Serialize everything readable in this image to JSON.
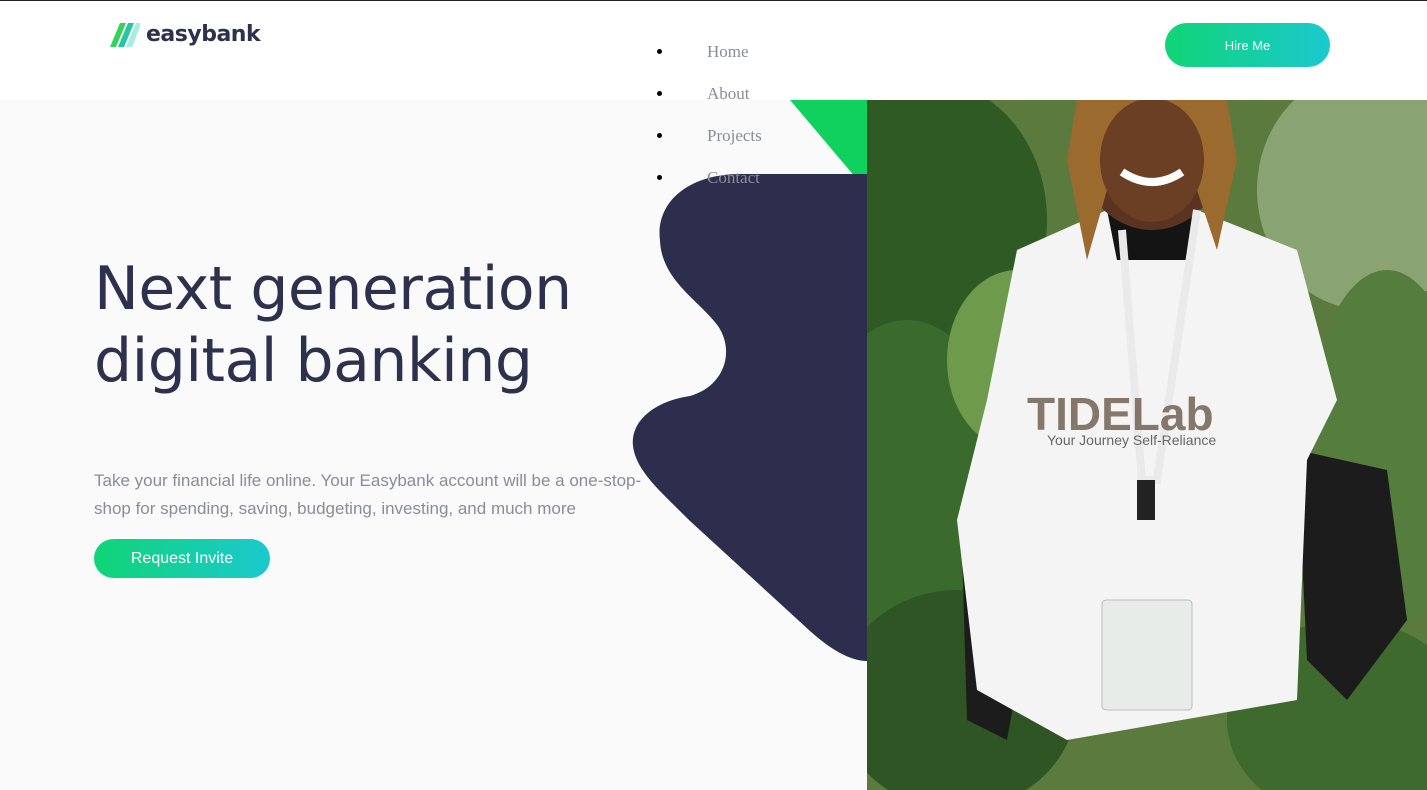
{
  "brand": {
    "name": "easybank"
  },
  "nav": {
    "items": [
      "Home",
      "About",
      "Projects",
      "Contact"
    ]
  },
  "header": {
    "cta_label": "Hire Me"
  },
  "hero": {
    "title_line1": "Next generation",
    "title_line2": "digital banking",
    "text": "Take your financial life online. Your Easybank account will be a one-stop-shop for spending, saving, budgeting, investing, and much more",
    "cta_label": "Request Invite",
    "image": {
      "shirt_text": "TIDELab",
      "shirt_subtext": "Your Journey Self-Reliance"
    }
  },
  "colors": {
    "dark_blue": "#2d314d",
    "lime_green": "#31d35c",
    "bright_cyan": "#2bb7da",
    "grayish_blue": "#9698a6"
  }
}
